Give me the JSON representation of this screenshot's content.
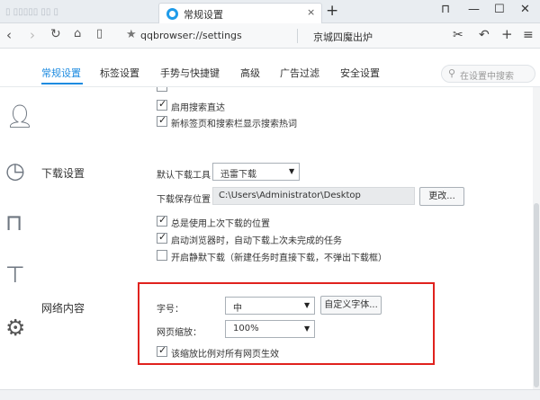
{
  "tabs": [
    {
      "title": "常规设置",
      "close": "×"
    }
  ],
  "new_tab": "+",
  "window_controls": [
    "⊓",
    "—",
    "☐",
    "✕"
  ],
  "address_bar": {
    "url": "qqbrowser://settings",
    "search_engine": "京城四魔出炉"
  },
  "settings_nav": {
    "tabs": [
      "常规设置",
      "标签设置",
      "手势与快捷键",
      "高级",
      "广告过滤",
      "安全设置"
    ],
    "active_index": 0,
    "search_placeholder": "在设置中搜索"
  },
  "search_section": {
    "options": [
      {
        "label": "启用搜索直达",
        "checked": true
      },
      {
        "label": "新标签页和搜索栏显示搜索热词",
        "checked": true
      }
    ]
  },
  "download_section": {
    "title": "下载设置",
    "default_tool_label": "默认下载工具",
    "default_tool_value": "迅雷下载",
    "save_location_label": "下载保存位置",
    "save_location_value": "C:\\Users\\Administrator\\Desktop",
    "change_button": "更改...",
    "options": [
      {
        "label": "总是使用上次下载的位置",
        "checked": true
      },
      {
        "label": "启动浏览器时，自动下载上次未完成的任务",
        "checked": true
      },
      {
        "label": "开启静默下载（新建任务时直接下载，不弹出下载框）",
        "checked": false
      }
    ]
  },
  "web_content_section": {
    "title": "网络内容",
    "font_size_label": "字号：",
    "font_size_value": "中",
    "custom_font_button": "自定义字体...",
    "zoom_label": "网页缩放：",
    "zoom_value": "100%",
    "apply_zoom_option": {
      "label": "该缩放比例对所有网页生效",
      "checked": true
    }
  },
  "colors": {
    "accent": "#1d8be0",
    "highlight": "#e0221e"
  }
}
